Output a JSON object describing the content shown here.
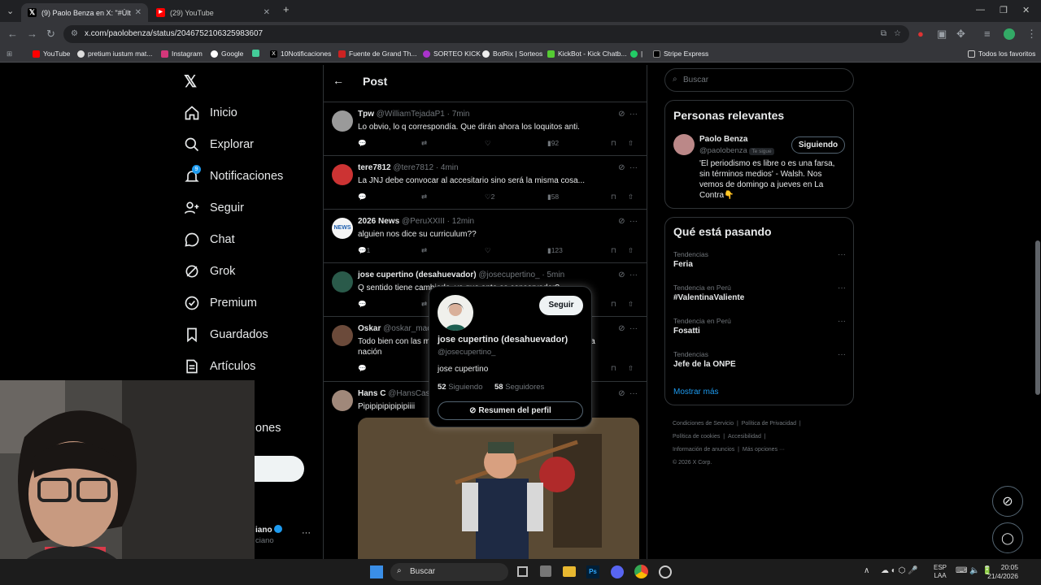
{
  "browser": {
    "tabs": [
      {
        "title": "(9) Paolo Benza en X: \"#Último",
        "icon": "x-logo-icon"
      },
      {
        "title": "(29) YouTube",
        "icon": "youtube-icon"
      }
    ],
    "url": "x.com/paolobenza/status/2046752106325983607",
    "bookmarks": [
      "YouTube",
      "pretium iustum mat...",
      "Instagram",
      "Google",
      "10Notificaciones",
      "Fuente de Grand Th...",
      "SORTEO KICK",
      "BotRix | Sorteos",
      "KickBot - Kick Chatb...",
      "Stripe Express"
    ],
    "all_favorites": "Todos los favoritos"
  },
  "nav": {
    "items": [
      "Inicio",
      "Explorar",
      "Notificaciones",
      "Seguir",
      "Chat",
      "Grok",
      "Premium",
      "Guardados",
      "Artículos"
    ],
    "notif_badge": "9",
    "more_partial": "ones",
    "post_button_partial": "r",
    "account_partial_name": "iano",
    "account_partial_handle": "ciano",
    "more_dots": "···"
  },
  "main": {
    "title": "Post",
    "replies": [
      {
        "name": "Tpw",
        "handle": "@WilliamTejadaP1",
        "time": "· 7min",
        "text": "Lo obvio, lo q correspondía. Que dirán ahora los loquitos anti.",
        "replies": "",
        "likes": "",
        "views": "92",
        "avatar_color": "#8a8a8a"
      },
      {
        "name": "tere7812",
        "handle": "@tere7812",
        "time": "· 4min",
        "text": "La JNJ debe convocar al accesitario sino será la misma cosa...",
        "replies": "",
        "likes": "2",
        "views": "58",
        "avatar_color": "#c33"
      },
      {
        "name": "2026 News",
        "handle": "@PeruXXIII",
        "time": "· 12min",
        "text": "alguien nos dice su curriculum??",
        "replies": "1",
        "likes": "",
        "views": "123",
        "avatar_color": "#f5f5f5"
      },
      {
        "name": "jose cupertino (desahuevador)",
        "handle": "@josecupertino_",
        "time": "· 5min",
        "text": "Q sentido tiene cambiarlo, ya que ante es conservador?",
        "replies": "",
        "likes": "",
        "views": "",
        "avatar_color": "#2a5a4a"
      },
      {
        "name": "Oskar",
        "handle": "@oskar_mac",
        "time": "",
        "text": "Todo bien con las medidas, pero hay que ser activos críticos de la nación",
        "replies": "",
        "likes": "",
        "views": "",
        "avatar_color": "#6b4a3a"
      },
      {
        "name": "Hans C",
        "handle": "@HansCas",
        "time": "",
        "text": "Pipipipipipipipiiii",
        "replies": "",
        "likes": "",
        "views": "",
        "avatar_color": "#a0887a"
      }
    ]
  },
  "popover": {
    "name": "jose cupertino (desahuevador)",
    "handle": "@josecupertino_",
    "bio": "jose cupertino",
    "following_count": "52",
    "following_label": "Siguiendo",
    "followers_count": "58",
    "followers_label": "Seguidores",
    "follow_button": "Seguir",
    "summary_button": "Resumen del perfil"
  },
  "right": {
    "search_placeholder": "Buscar",
    "relevant": {
      "title": "Personas relevantes",
      "name": "Paolo Benza",
      "handle": "@paolobenza",
      "follows_you": "Te sigue",
      "button": "Siguiendo",
      "bio": "'El periodismo es libre o es una farsa, sin términos medios' - Walsh. Nos vemos de domingo a jueves en La Contra👇"
    },
    "happening": {
      "title": "Qué está pasando",
      "trends": [
        {
          "label": "Tendencias",
          "topic": "Feria"
        },
        {
          "label": "Tendencia en Perú",
          "topic": "#ValentinaValiente"
        },
        {
          "label": "Tendencia en Perú",
          "topic": "Fosatti"
        },
        {
          "label": "Tendencias",
          "topic": "Jefe de la ONPE"
        }
      ],
      "show_more": "Mostrar más"
    },
    "footer": [
      "Condiciones de Servicio",
      "Política de Privacidad",
      "Política de cookies",
      "Accesibilidad",
      "Información de anuncios",
      "Más opciones ···",
      "© 2026 X Corp."
    ]
  },
  "taskbar": {
    "search": "Buscar",
    "lang1": "ESP",
    "lang2": "LAA",
    "time": "20:05",
    "date": "21/4/2026"
  }
}
